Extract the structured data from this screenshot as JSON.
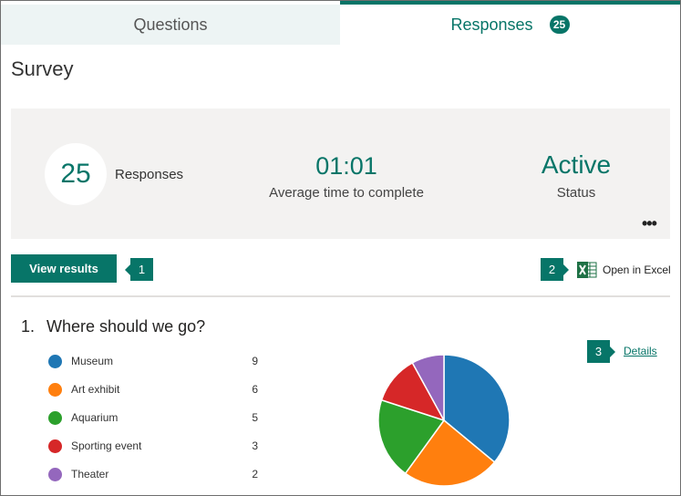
{
  "tabs": {
    "questions_label": "Questions",
    "responses_label": "Responses",
    "responses_count": "25"
  },
  "form_title": "Survey",
  "summary": {
    "responses_count": "25",
    "responses_label": "Responses",
    "avg_time": "01:01",
    "avg_time_label": "Average time to complete",
    "status": "Active",
    "status_label": "Status",
    "more_icon": "ellipsis-icon"
  },
  "actions": {
    "view_results_label": "View results",
    "callout_1": "1",
    "callout_2": "2",
    "open_excel_label": "Open in Excel",
    "excel_icon": "excel-icon"
  },
  "question": {
    "number": "1.",
    "title": "Where should we go?",
    "details_label": "Details",
    "callout_3": "3",
    "options": [
      {
        "label": "Museum",
        "count": 9,
        "color": "#1f77b4"
      },
      {
        "label": "Art exhibit",
        "count": 6,
        "color": "#ff7f0e"
      },
      {
        "label": "Aquarium",
        "count": 5,
        "color": "#2ca02c"
      },
      {
        "label": "Sporting event",
        "count": 3,
        "color": "#d62728"
      },
      {
        "label": "Theater",
        "count": 2,
        "color": "#9467bd"
      }
    ]
  },
  "colors": {
    "accent": "#077568",
    "tab_inactive_bg": "#edf4f4",
    "panel_bg": "#f3f2f1"
  }
}
